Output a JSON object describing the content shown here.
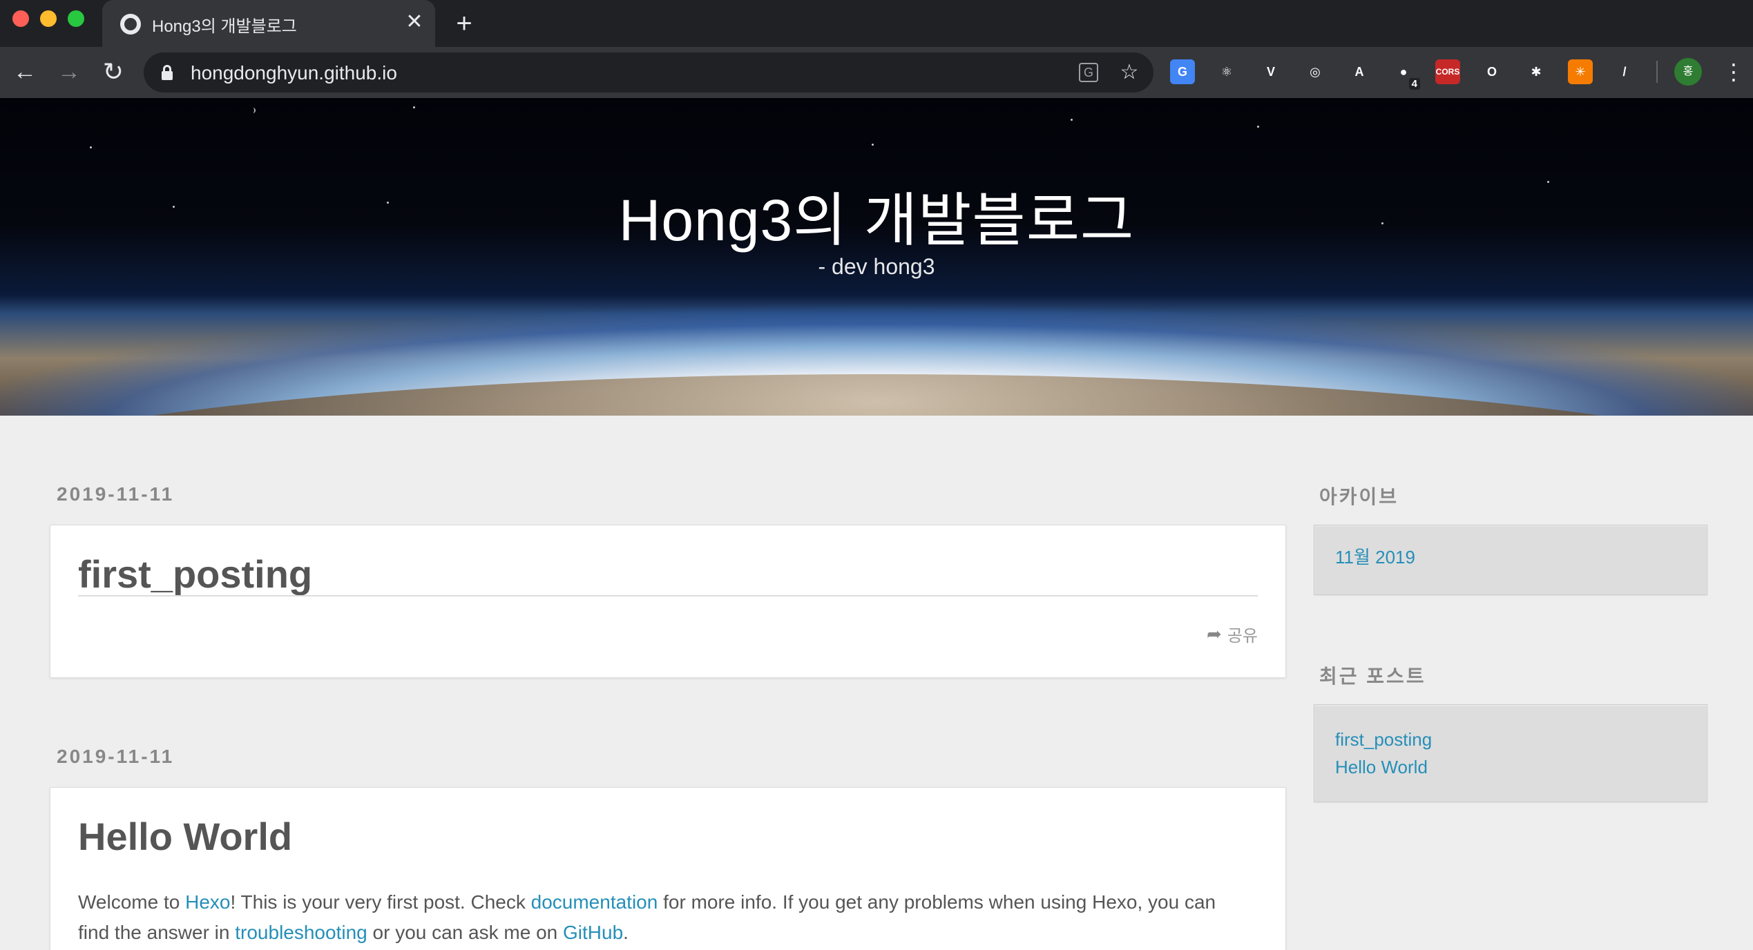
{
  "browser": {
    "tab_title": "Hong3의 개발블로그",
    "url": "hongdonghyun.github.io",
    "extensions": [
      {
        "name": "google-translate-extension-icon",
        "label": "G",
        "color": "#4285f4"
      },
      {
        "name": "react-devtools-icon",
        "label": "⚛",
        "color": "#35363a"
      },
      {
        "name": "vue-devtools-icon",
        "label": "V",
        "color": "#35363a"
      },
      {
        "name": "target-extension-icon",
        "label": "◎",
        "color": "#35363a"
      },
      {
        "name": "angular-extension-icon",
        "label": "A",
        "color": "#35363a"
      },
      {
        "name": "badge-extension-icon",
        "label": "●",
        "color": "#35363a",
        "badge": "4"
      },
      {
        "name": "cors-extension-icon",
        "label": "CORS",
        "color": "#c62828"
      },
      {
        "name": "ring-extension-icon",
        "label": "O",
        "color": "#35363a"
      },
      {
        "name": "bug-extension-icon",
        "label": "✱",
        "color": "#35363a"
      },
      {
        "name": "orange-extension-icon",
        "label": "✳",
        "color": "#f57c00"
      },
      {
        "name": "pen-extension-icon",
        "label": "/",
        "color": "#35363a"
      }
    ],
    "profile_label": "홍"
  },
  "banner": {
    "title": "Hong3의 개발블로그",
    "subtitle": "- dev hong3"
  },
  "posts": [
    {
      "date": "2019-11-11",
      "title": "first_posting",
      "share_label": "공유"
    },
    {
      "date": "2019-11-11",
      "title": "Hello World",
      "body": {
        "p1": "Welcome to ",
        "link_hexo": "Hexo",
        "p2": "! This is your very first post. Check ",
        "link_docs": "documentation",
        "p3": " for more info. If you get any problems when using Hexo, you can find the answer in ",
        "link_trouble": "troubleshooting",
        "p4": " or you can ask me on ",
        "link_github": "GitHub",
        "p5": "."
      }
    }
  ],
  "sidebar": {
    "archive_title": "아카이브",
    "archive_items": [
      "11월 2019"
    ],
    "recent_title": "최근 포스트",
    "recent_items": [
      "first_posting",
      "Hello World"
    ]
  }
}
